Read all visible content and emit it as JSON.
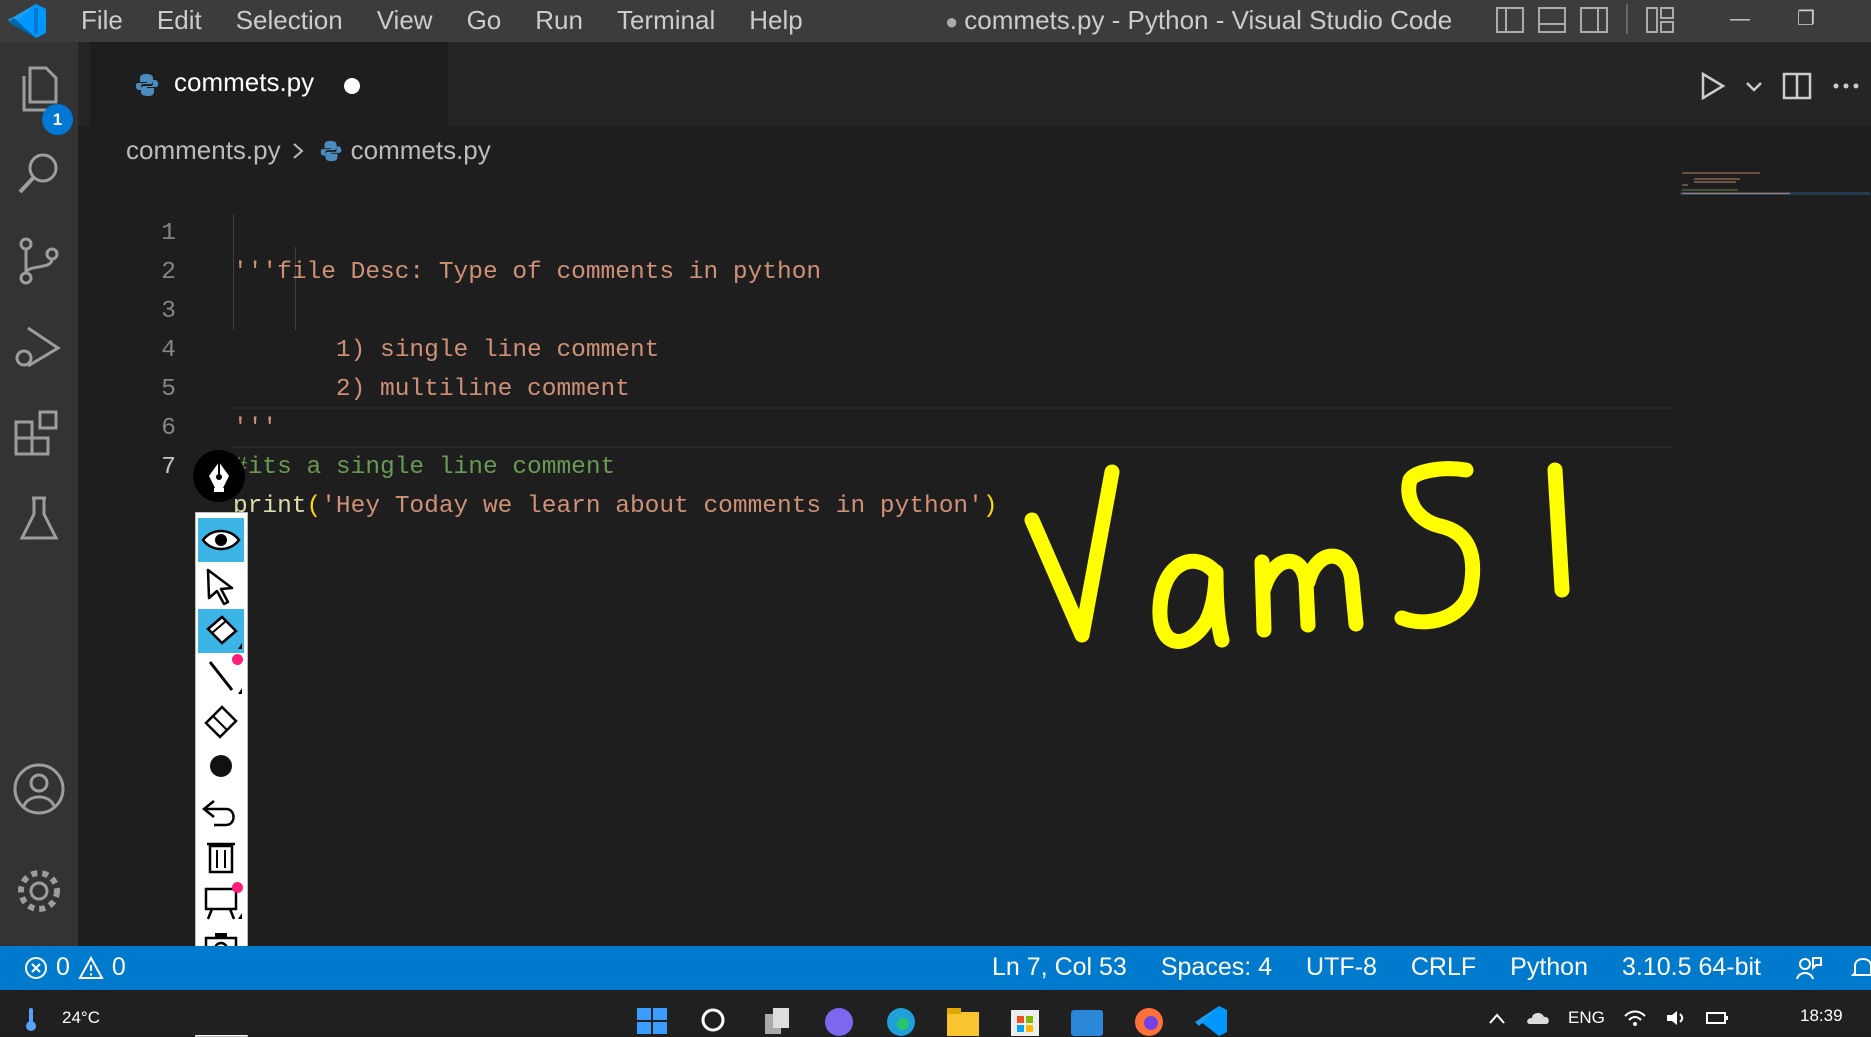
{
  "window": {
    "title": "commets.py - Python - Visual Studio Code",
    "menu": [
      "File",
      "Edit",
      "Selection",
      "View",
      "Go",
      "Run",
      "Terminal",
      "Help"
    ]
  },
  "activity_bar": {
    "explorer_badge": "1",
    "items": [
      "explorer",
      "search",
      "source-control",
      "run-and-debug",
      "extensions",
      "testing",
      "accounts",
      "manage"
    ]
  },
  "tab": {
    "label": "commets.py",
    "dirty": true
  },
  "breadcrumb": {
    "folder": "comments.py",
    "file": "commets.py"
  },
  "editor": {
    "lines": [
      {
        "num": "1",
        "text": "'''file Desc: Type of comments in python"
      },
      {
        "num": "2",
        "text": ""
      },
      {
        "num": "3",
        "text": "       1) single line comment"
      },
      {
        "num": "4",
        "text": "       2) multiline comment"
      },
      {
        "num": "5",
        "text": "'''"
      },
      {
        "num": "6",
        "text": "#its a single line comment"
      },
      {
        "num": "7",
        "fn": "print",
        "open": "(",
        "str": "'Hey Today we learn about comments in python'",
        "close": ")"
      }
    ],
    "current_line": 7
  },
  "overlay": {
    "handwriting": "VamSI",
    "color": "#ffff00"
  },
  "status_bar": {
    "errors": "0",
    "warnings": "0",
    "position": "Ln 7, Col 53",
    "spaces": "Spaces: 4",
    "encoding": "UTF-8",
    "eol": "CRLF",
    "language": "Python",
    "interpreter": "3.10.5 64-bit"
  },
  "taskbar": {
    "temperature": "24°C",
    "language": "ENG",
    "time": "18:39"
  },
  "colors": {
    "accent": "#007acc",
    "string": "#ce9178",
    "comment": "#6a9955",
    "function": "#dcdcaa",
    "bracket": "#ffd700"
  }
}
